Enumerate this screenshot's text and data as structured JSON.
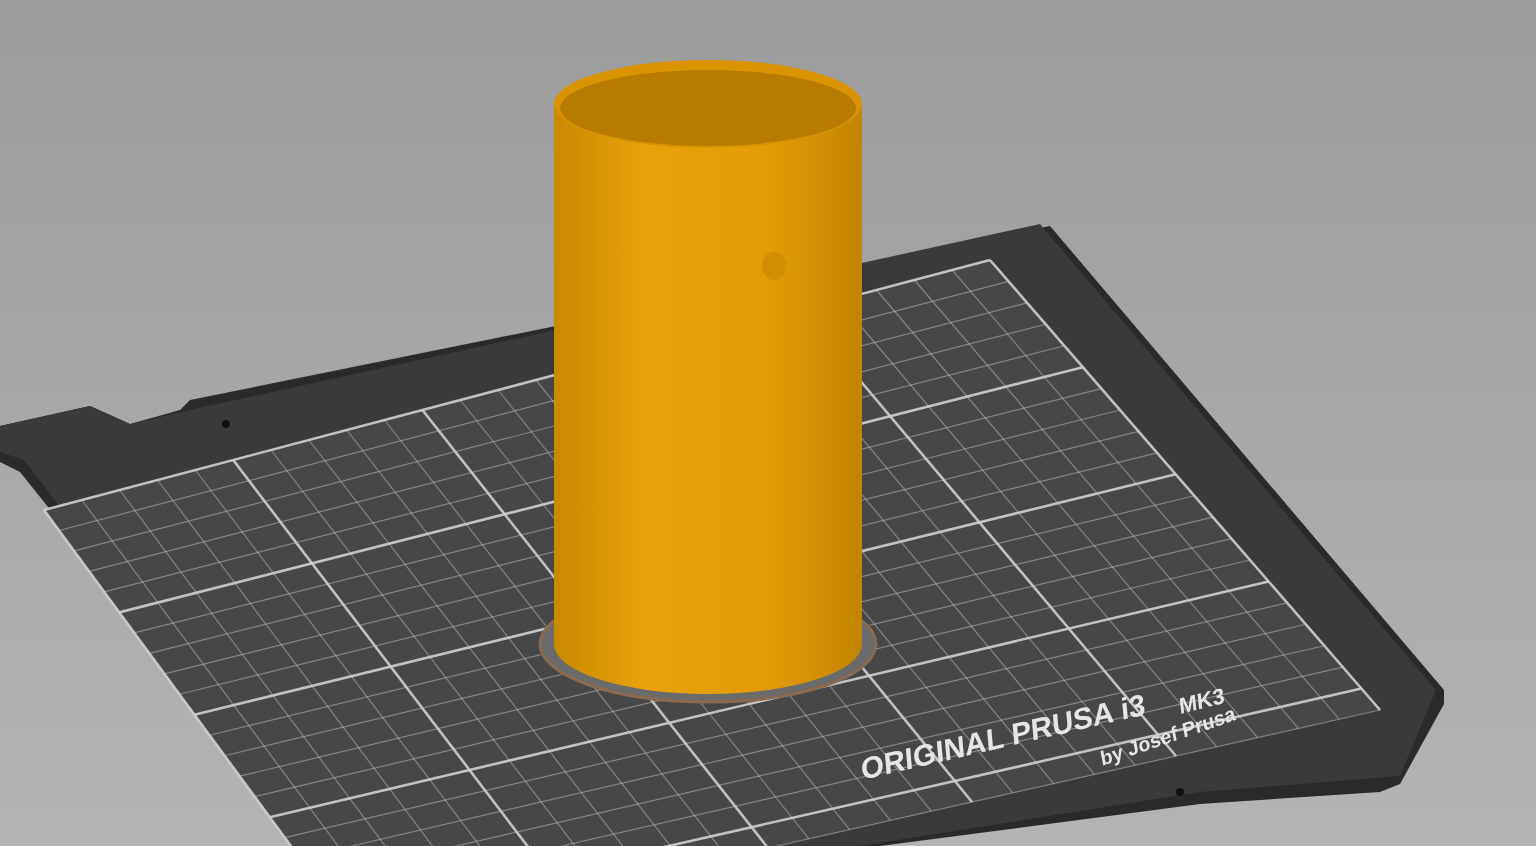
{
  "bed": {
    "label": "ORIGINAL PRUSA i3",
    "model": "MK3",
    "byline": "by Josef Prusa"
  }
}
